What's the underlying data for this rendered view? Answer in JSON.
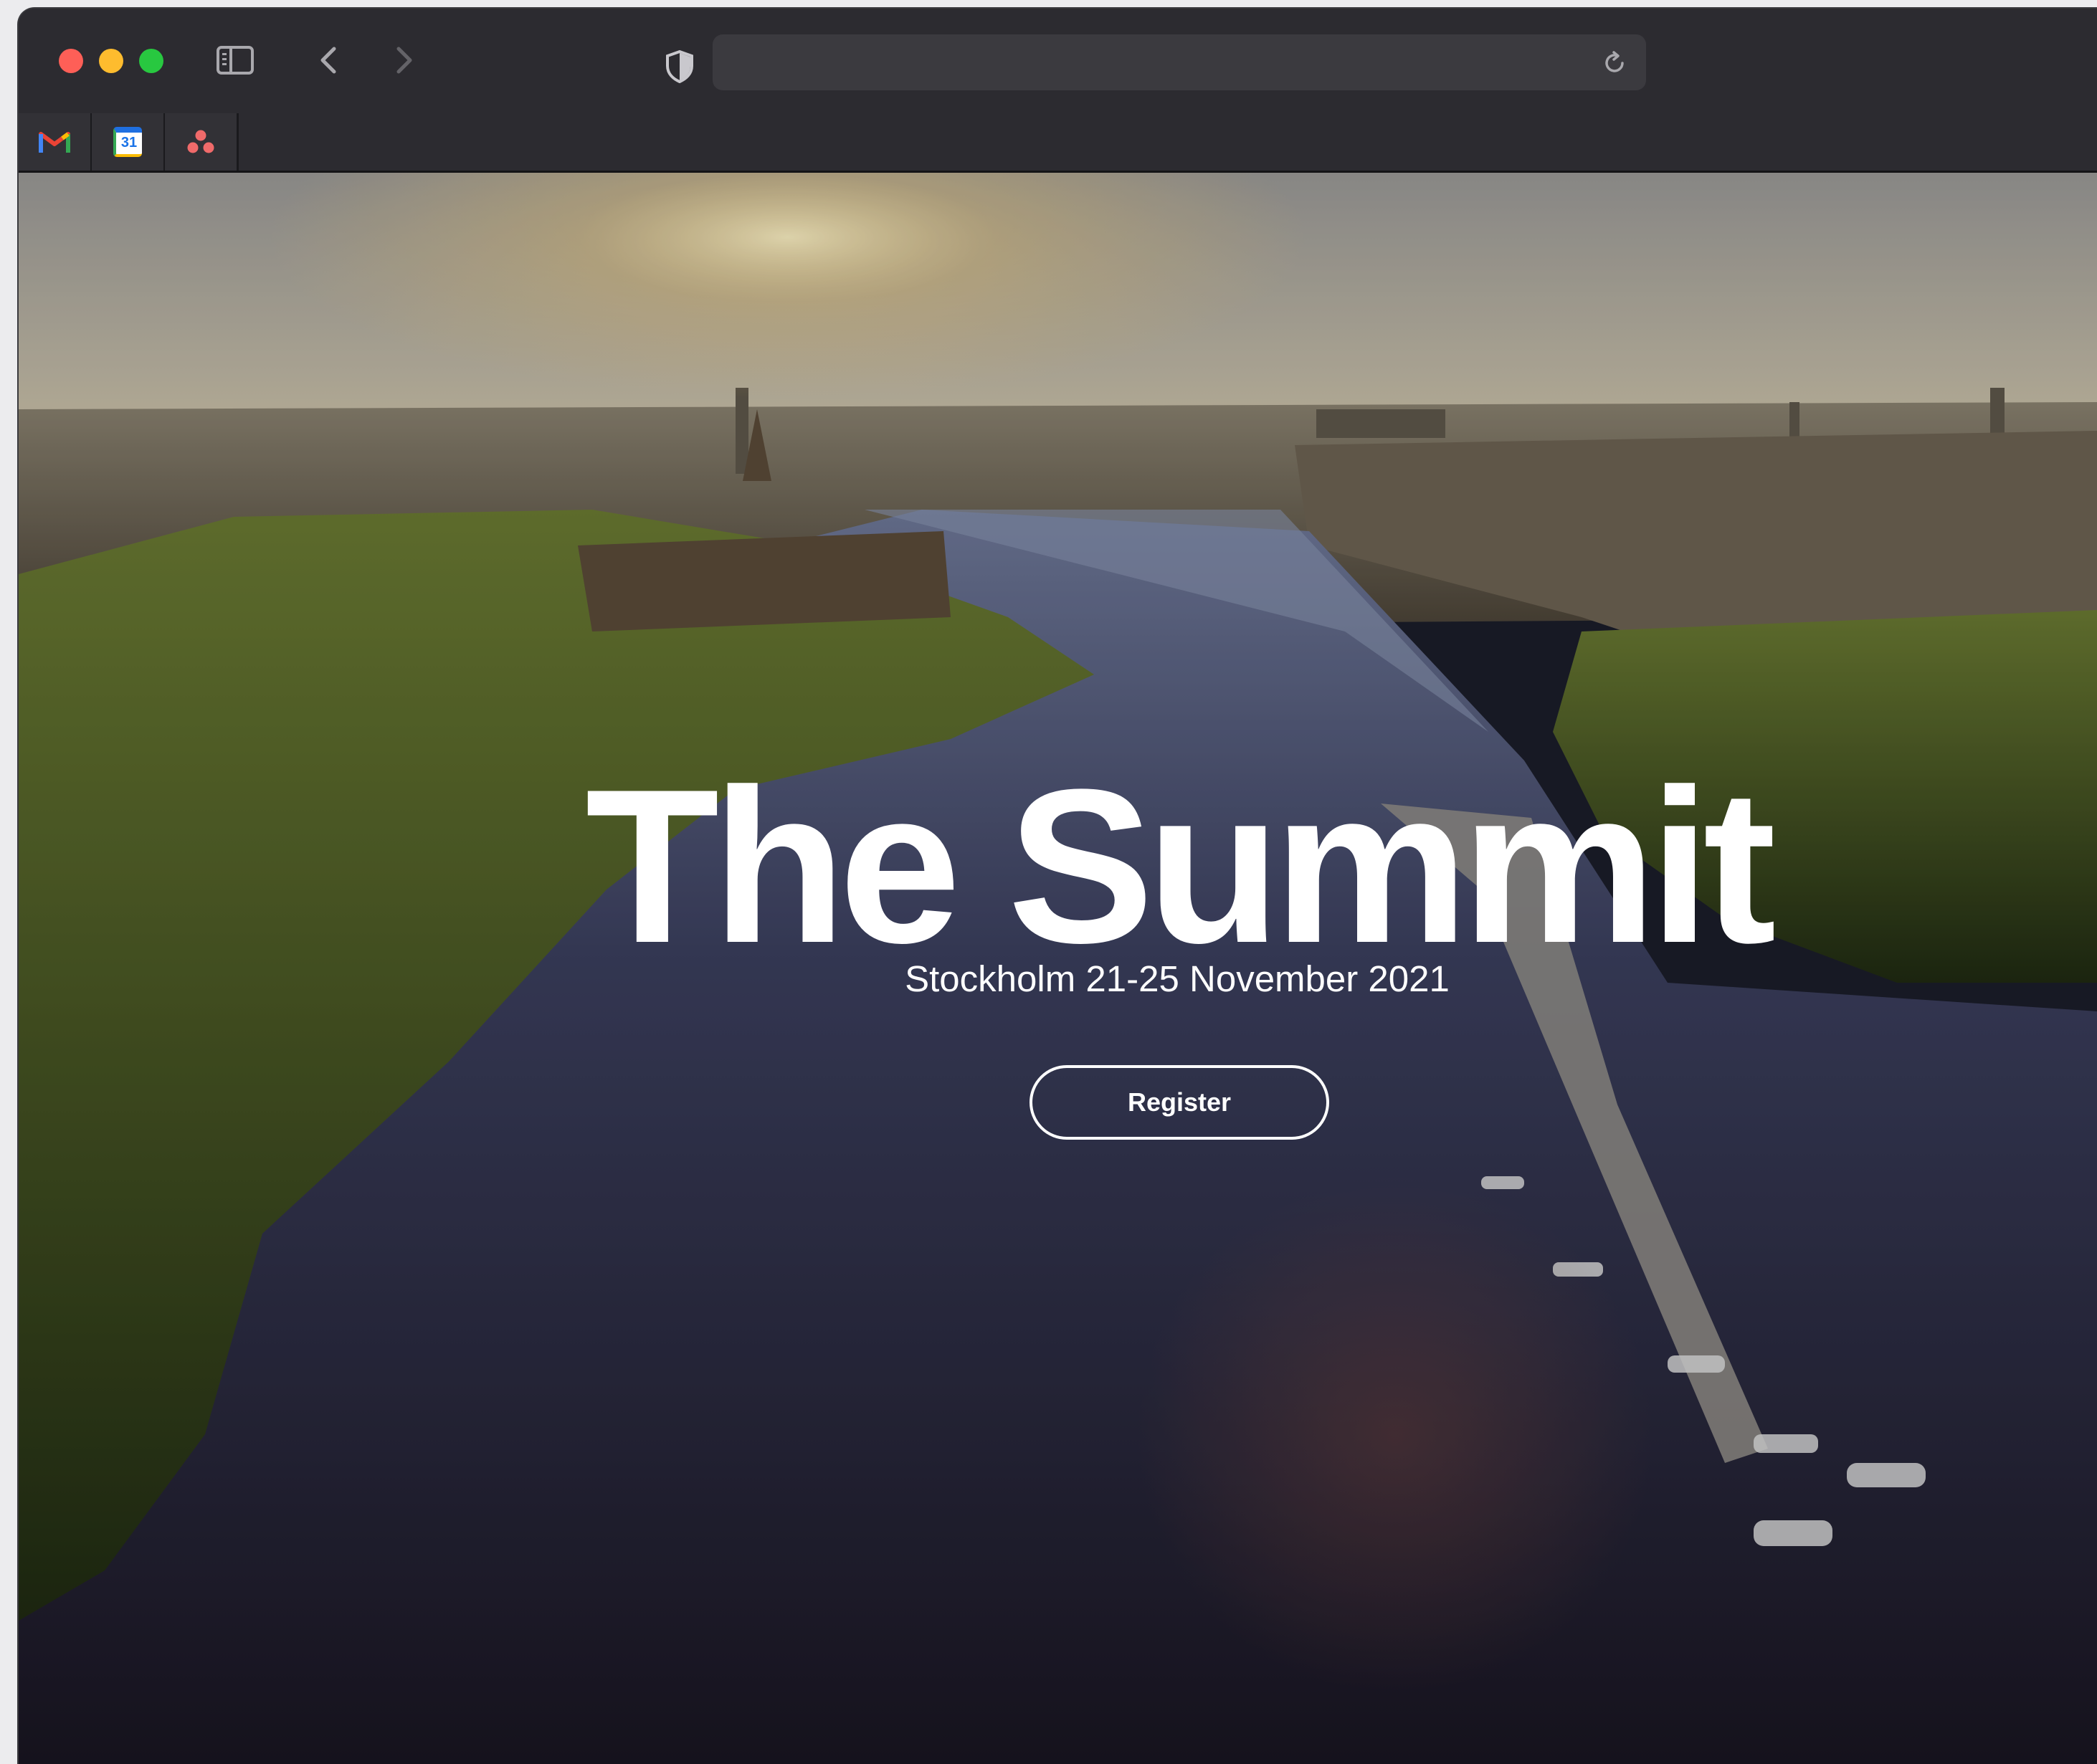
{
  "browser": {
    "address_bar": {
      "value": ""
    },
    "pinned_tabs": [
      {
        "name": "Gmail",
        "icon": "gmail-icon"
      },
      {
        "name": "Google Calendar",
        "icon": "google-calendar-icon",
        "text": "31"
      },
      {
        "name": "Asana",
        "icon": "asana-icon"
      }
    ]
  },
  "hero": {
    "title": "The Summit",
    "subtitle": "Stockholm 21-25 November 2021",
    "register_label": "Register",
    "background": "aerial-city-waterfront-photo"
  },
  "colors": {
    "close": "#fe5f57",
    "minimize": "#febc2e",
    "maximize": "#28c840",
    "toolbar": "#2c2b30",
    "text": "#ffffff"
  }
}
